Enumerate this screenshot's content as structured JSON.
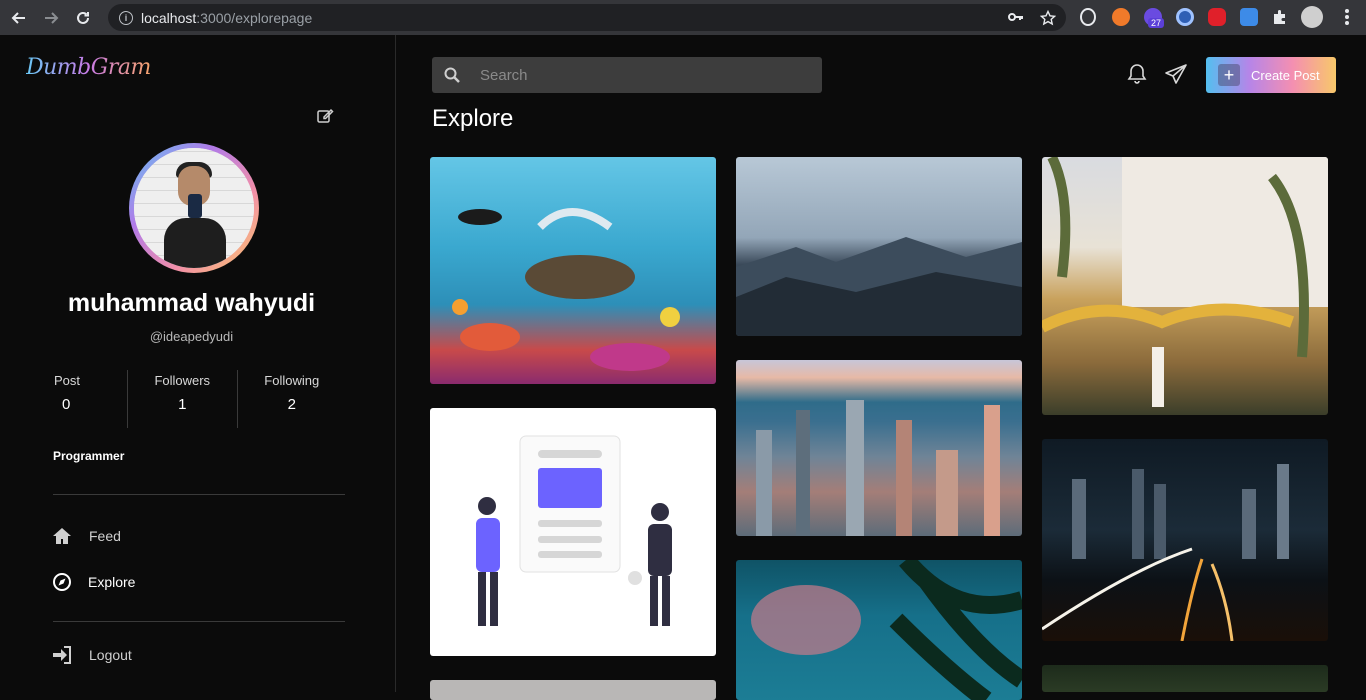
{
  "browser": {
    "url_host": "localhost",
    "url_path": ":3000/explorepage",
    "extension_badge": "27"
  },
  "app": {
    "logo": "DumbGram"
  },
  "profile": {
    "name": "muhammad wahyudi",
    "handle": "@ideapedyudi",
    "bio": "Programmer",
    "stats": [
      {
        "label": "Post",
        "value": "0"
      },
      {
        "label": "Followers",
        "value": "1"
      },
      {
        "label": "Following",
        "value": "2"
      }
    ]
  },
  "menu": {
    "feed": "Feed",
    "explore": "Explore",
    "logout": "Logout"
  },
  "header": {
    "search_placeholder": "Search",
    "create_post": "Create Post"
  },
  "page": {
    "title": "Explore"
  }
}
